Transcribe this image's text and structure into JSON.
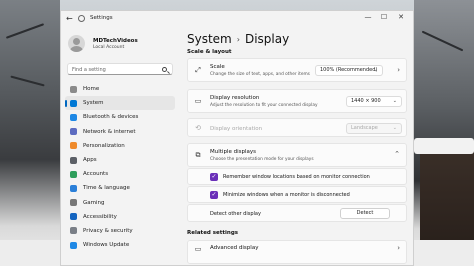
{
  "window": {
    "title": "Settings",
    "controls": [
      "—",
      "☐",
      "✕"
    ]
  },
  "profile": {
    "name": "MDTechVideos",
    "subtitle": "Local Account"
  },
  "search": {
    "placeholder": "Find a setting"
  },
  "sidebar": {
    "items": [
      {
        "label": "Home",
        "icon": "home-icon",
        "color": "#8a8a8a",
        "active": false
      },
      {
        "label": "System",
        "icon": "system-icon",
        "color": "#0078d4",
        "active": true
      },
      {
        "label": "Bluetooth & devices",
        "icon": "bluetooth-icon",
        "color": "#1e88e5",
        "active": false
      },
      {
        "label": "Network & internet",
        "icon": "network-icon",
        "color": "#5c6bc0",
        "active": false
      },
      {
        "label": "Personalization",
        "icon": "personalization-icon",
        "color": "#ef8a2b",
        "active": false
      },
      {
        "label": "Apps",
        "icon": "apps-icon",
        "color": "#5b5f66",
        "active": false
      },
      {
        "label": "Accounts",
        "icon": "accounts-icon",
        "color": "#2e9e5b",
        "active": false
      },
      {
        "label": "Time & language",
        "icon": "time-language-icon",
        "color": "#2b7fd8",
        "active": false
      },
      {
        "label": "Gaming",
        "icon": "gaming-icon",
        "color": "#777777",
        "active": false
      },
      {
        "label": "Accessibility",
        "icon": "accessibility-icon",
        "color": "#1565c0",
        "active": false
      },
      {
        "label": "Privacy & security",
        "icon": "shield-icon",
        "color": "#7a7f87",
        "active": false
      },
      {
        "label": "Windows Update",
        "icon": "windows-update-icon",
        "color": "#1e88e5",
        "active": false
      }
    ]
  },
  "main": {
    "breadcrumb_parent": "System",
    "breadcrumb_separator": "›",
    "breadcrumb_current": "Display",
    "section_scale_layout": "Scale & layout",
    "scale": {
      "title": "Scale",
      "subtitle": "Change the size of text, apps, and other items",
      "value": "100% (Recommended)"
    },
    "resolution": {
      "title": "Display resolution",
      "subtitle": "Adjust the resolution to fit your connected display",
      "value": "1440 × 900"
    },
    "orientation": {
      "title": "Display orientation",
      "value": "Landscape"
    },
    "multiple_displays": {
      "title": "Multiple displays",
      "subtitle": "Choose the presentation mode for your displays",
      "options": [
        {
          "label": "Remember window locations based on monitor connection",
          "checked": true
        },
        {
          "label": "Minimize windows when a monitor is disconnected",
          "checked": true
        }
      ],
      "detect_label": "Detect other display",
      "detect_button": "Detect"
    },
    "section_related": "Related settings",
    "related_first": "Advanced display"
  }
}
